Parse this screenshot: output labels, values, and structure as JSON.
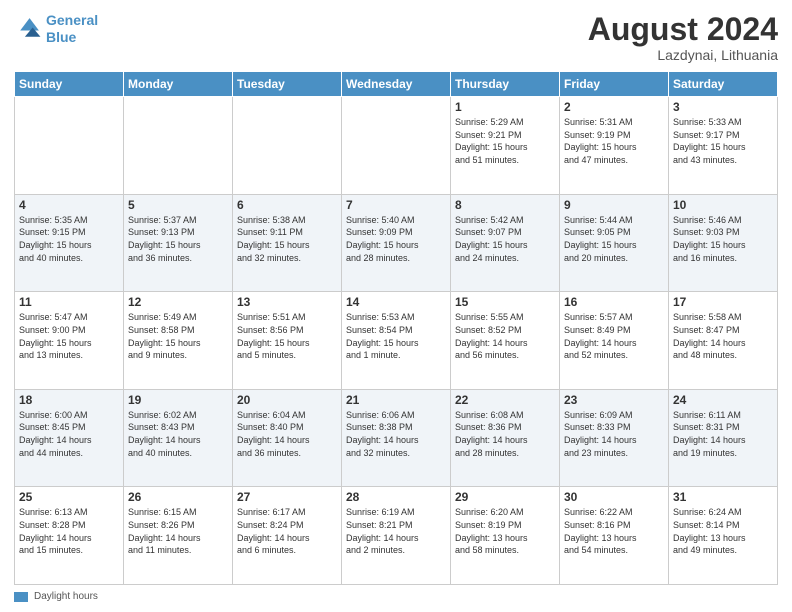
{
  "header": {
    "logo_line1": "General",
    "logo_line2": "Blue",
    "month": "August 2024",
    "location": "Lazdynai, Lithuania"
  },
  "days_of_week": [
    "Sunday",
    "Monday",
    "Tuesday",
    "Wednesday",
    "Thursday",
    "Friday",
    "Saturday"
  ],
  "legend": {
    "label": "Daylight hours"
  },
  "weeks": [
    [
      {
        "num": "",
        "info": ""
      },
      {
        "num": "",
        "info": ""
      },
      {
        "num": "",
        "info": ""
      },
      {
        "num": "",
        "info": ""
      },
      {
        "num": "1",
        "info": "Sunrise: 5:29 AM\nSunset: 9:21 PM\nDaylight: 15 hours\nand 51 minutes."
      },
      {
        "num": "2",
        "info": "Sunrise: 5:31 AM\nSunset: 9:19 PM\nDaylight: 15 hours\nand 47 minutes."
      },
      {
        "num": "3",
        "info": "Sunrise: 5:33 AM\nSunset: 9:17 PM\nDaylight: 15 hours\nand 43 minutes."
      }
    ],
    [
      {
        "num": "4",
        "info": "Sunrise: 5:35 AM\nSunset: 9:15 PM\nDaylight: 15 hours\nand 40 minutes."
      },
      {
        "num": "5",
        "info": "Sunrise: 5:37 AM\nSunset: 9:13 PM\nDaylight: 15 hours\nand 36 minutes."
      },
      {
        "num": "6",
        "info": "Sunrise: 5:38 AM\nSunset: 9:11 PM\nDaylight: 15 hours\nand 32 minutes."
      },
      {
        "num": "7",
        "info": "Sunrise: 5:40 AM\nSunset: 9:09 PM\nDaylight: 15 hours\nand 28 minutes."
      },
      {
        "num": "8",
        "info": "Sunrise: 5:42 AM\nSunset: 9:07 PM\nDaylight: 15 hours\nand 24 minutes."
      },
      {
        "num": "9",
        "info": "Sunrise: 5:44 AM\nSunset: 9:05 PM\nDaylight: 15 hours\nand 20 minutes."
      },
      {
        "num": "10",
        "info": "Sunrise: 5:46 AM\nSunset: 9:03 PM\nDaylight: 15 hours\nand 16 minutes."
      }
    ],
    [
      {
        "num": "11",
        "info": "Sunrise: 5:47 AM\nSunset: 9:00 PM\nDaylight: 15 hours\nand 13 minutes."
      },
      {
        "num": "12",
        "info": "Sunrise: 5:49 AM\nSunset: 8:58 PM\nDaylight: 15 hours\nand 9 minutes."
      },
      {
        "num": "13",
        "info": "Sunrise: 5:51 AM\nSunset: 8:56 PM\nDaylight: 15 hours\nand 5 minutes."
      },
      {
        "num": "14",
        "info": "Sunrise: 5:53 AM\nSunset: 8:54 PM\nDaylight: 15 hours\nand 1 minute."
      },
      {
        "num": "15",
        "info": "Sunrise: 5:55 AM\nSunset: 8:52 PM\nDaylight: 14 hours\nand 56 minutes."
      },
      {
        "num": "16",
        "info": "Sunrise: 5:57 AM\nSunset: 8:49 PM\nDaylight: 14 hours\nand 52 minutes."
      },
      {
        "num": "17",
        "info": "Sunrise: 5:58 AM\nSunset: 8:47 PM\nDaylight: 14 hours\nand 48 minutes."
      }
    ],
    [
      {
        "num": "18",
        "info": "Sunrise: 6:00 AM\nSunset: 8:45 PM\nDaylight: 14 hours\nand 44 minutes."
      },
      {
        "num": "19",
        "info": "Sunrise: 6:02 AM\nSunset: 8:43 PM\nDaylight: 14 hours\nand 40 minutes."
      },
      {
        "num": "20",
        "info": "Sunrise: 6:04 AM\nSunset: 8:40 PM\nDaylight: 14 hours\nand 36 minutes."
      },
      {
        "num": "21",
        "info": "Sunrise: 6:06 AM\nSunset: 8:38 PM\nDaylight: 14 hours\nand 32 minutes."
      },
      {
        "num": "22",
        "info": "Sunrise: 6:08 AM\nSunset: 8:36 PM\nDaylight: 14 hours\nand 28 minutes."
      },
      {
        "num": "23",
        "info": "Sunrise: 6:09 AM\nSunset: 8:33 PM\nDaylight: 14 hours\nand 23 minutes."
      },
      {
        "num": "24",
        "info": "Sunrise: 6:11 AM\nSunset: 8:31 PM\nDaylight: 14 hours\nand 19 minutes."
      }
    ],
    [
      {
        "num": "25",
        "info": "Sunrise: 6:13 AM\nSunset: 8:28 PM\nDaylight: 14 hours\nand 15 minutes."
      },
      {
        "num": "26",
        "info": "Sunrise: 6:15 AM\nSunset: 8:26 PM\nDaylight: 14 hours\nand 11 minutes."
      },
      {
        "num": "27",
        "info": "Sunrise: 6:17 AM\nSunset: 8:24 PM\nDaylight: 14 hours\nand 6 minutes."
      },
      {
        "num": "28",
        "info": "Sunrise: 6:19 AM\nSunset: 8:21 PM\nDaylight: 14 hours\nand 2 minutes."
      },
      {
        "num": "29",
        "info": "Sunrise: 6:20 AM\nSunset: 8:19 PM\nDaylight: 13 hours\nand 58 minutes."
      },
      {
        "num": "30",
        "info": "Sunrise: 6:22 AM\nSunset: 8:16 PM\nDaylight: 13 hours\nand 54 minutes."
      },
      {
        "num": "31",
        "info": "Sunrise: 6:24 AM\nSunset: 8:14 PM\nDaylight: 13 hours\nand 49 minutes."
      }
    ]
  ]
}
